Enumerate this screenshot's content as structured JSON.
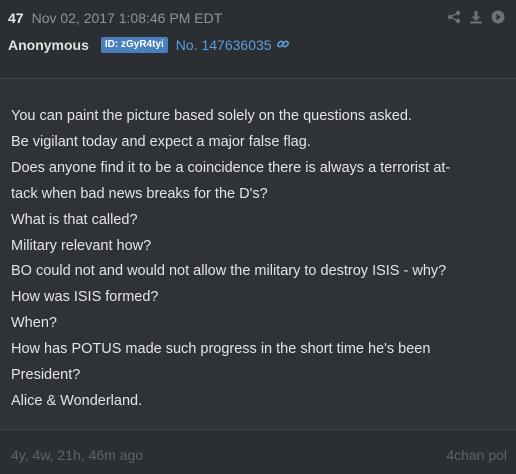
{
  "header": {
    "post_number": "47",
    "timestamp": "Nov 02, 2017 1:08:46 PM EDT",
    "author": "Anonymous",
    "id_badge": "ID: zGyR4tyi",
    "post_link": "No. 147636035",
    "actions": [
      "share-icon",
      "download-icon",
      "arrow-right-circle-icon"
    ],
    "link_icon": "link-icon"
  },
  "body": {
    "lines": [
      "You can paint the picture based solely on the questions asked.",
      "Be vigilant today and expect a major false flag.",
      "Does anyone find it to be a coincidence there is always a terrorist at-",
      "tack when bad news breaks for the D's?",
      "What is that called?",
      "Military relevant how?",
      "BO could not and would not allow the military to destroy ISIS - why?",
      "How was ISIS formed?",
      "When?",
      "How has POTUS made such progress in the short time he's been",
      "President?",
      "Alice & Wonderland."
    ]
  },
  "footer": {
    "age": "4y, 4w, 21h, 46m ago",
    "board": "4chan pol"
  },
  "colors": {
    "background": "#2f3338",
    "header_background": "#2b2f34",
    "text": "#e4e4e4",
    "muted": "#8d949b",
    "link": "#5d9ed9",
    "id_badge": "#4a7fbd"
  }
}
